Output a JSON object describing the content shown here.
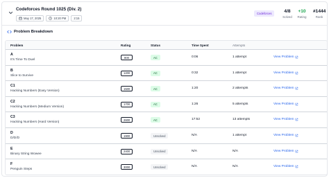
{
  "contest": {
    "title": "Codeforces Round 1025 (Div. 2)",
    "date": "May 17, 2025",
    "time": "10:20 PM",
    "duration": "2:15",
    "platform": "Codeforces"
  },
  "stats": [
    {
      "value": "4/8",
      "label": "Solved",
      "color": "#111827"
    },
    {
      "value": "+10",
      "label": "Rating",
      "color": "#16a34a"
    },
    {
      "value": "#1444",
      "label": "Rank",
      "color": "#111827"
    }
  ],
  "section_title": "Problem Breakdown",
  "table": {
    "headers": {
      "problem": "Problem",
      "rating": "Rating",
      "status": "Status",
      "time": "Time Spent",
      "attempts": "Attempts"
    },
    "rows": [
      {
        "id": "A",
        "name": "It's Time To Duel",
        "rating": "800",
        "status": "AC",
        "time": "0:06",
        "attempts": "1 attempt",
        "link": "View Problem"
      },
      {
        "id": "B",
        "name": "Slice to Survive",
        "rating": "1200",
        "status": "AC",
        "time": "0:32",
        "attempts": "1 attempt",
        "link": "View Problem"
      },
      {
        "id": "C1",
        "name": "Hacking Numbers (Easy Version)",
        "rating": "1500",
        "status": "AC",
        "time": "1:20",
        "attempts": "2 attempts",
        "link": "View Problem"
      },
      {
        "id": "C2",
        "name": "Hacking Numbers (Medium Version)",
        "rating": "1700",
        "status": "AC",
        "time": "1:26",
        "attempts": "5 attempts",
        "link": "View Problem"
      },
      {
        "id": "C3",
        "name": "Hacking Numbers (Hard Version)",
        "rating": "2600",
        "status": "AC",
        "time": "17:52",
        "attempts": "13 attempts",
        "link": "View Problem"
      },
      {
        "id": "D",
        "name": "D/D/D",
        "rating": "1900",
        "status": "Unsolved",
        "time": "N/A",
        "attempts": "1 attempt",
        "link": "View Problem"
      },
      {
        "id": "E",
        "name": "Binary String Wowee",
        "rating": "2400",
        "status": "Unsolved",
        "time": "N/A",
        "attempts": "N/A",
        "link": "View Problem"
      },
      {
        "id": "F",
        "name": "Penguin Steps",
        "rating": "3000",
        "status": "Unsolved",
        "time": "N/A",
        "attempts": "N/A",
        "link": "View Problem"
      }
    ]
  }
}
